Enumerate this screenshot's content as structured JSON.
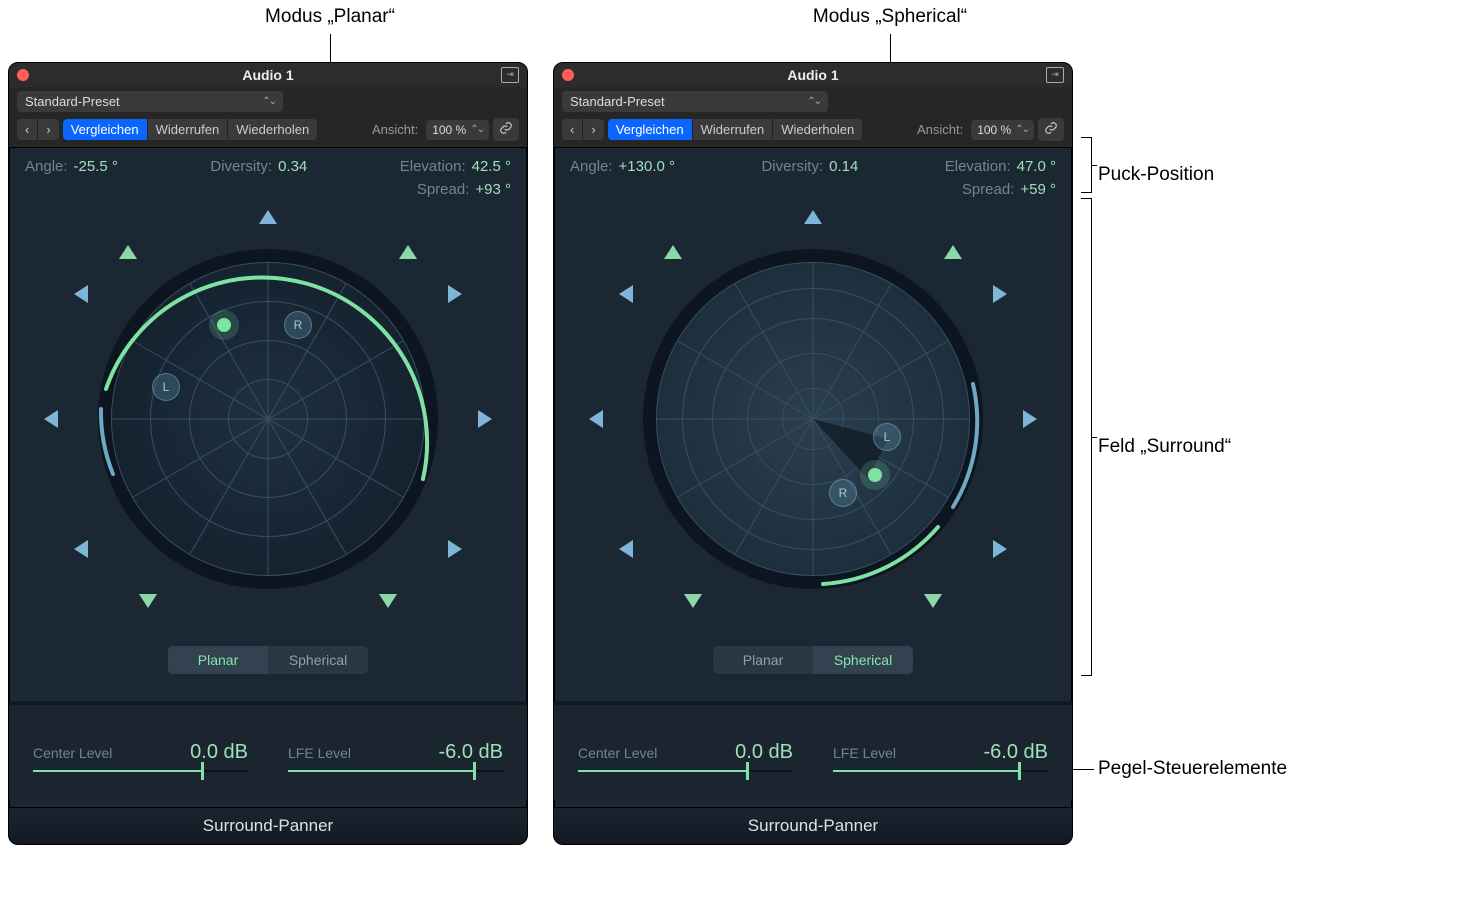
{
  "annotations": {
    "top_left": "Modus „Planar“",
    "top_right": "Modus „Spherical“",
    "right_1": "Puck-Position",
    "right_2": "Feld „Surround“",
    "right_3": "Pegel-Steuerelemente"
  },
  "shared": {
    "window_title": "Audio 1",
    "preset": "Standard-Preset",
    "nav_prev": "‹",
    "nav_next": "›",
    "btn_compare": "Vergleichen",
    "btn_undo": "Widerrufen",
    "btn_redo": "Wiederholen",
    "view_label": "Ansicht:",
    "zoom_value": "100 %",
    "link_glyph": "⧉",
    "labels": {
      "angle": "Angle:",
      "diversity": "Diversity:",
      "elevation": "Elevation:",
      "spread": "Spread:"
    },
    "mode_planar": "Planar",
    "mode_spherical": "Spherical",
    "center_level_label": "Center Level",
    "lfe_level_label": "LFE Level",
    "footer": "Surround-Panner"
  },
  "left": {
    "angle": "-25.5 °",
    "diversity": "0.34",
    "elevation": "42.5 °",
    "spread": "+93 °",
    "active_mode": "planar",
    "center_level": "0.0 dB",
    "center_fill_pct": 78,
    "lfe_level": "-6.0 dB",
    "lfe_fill_pct": 86
  },
  "right": {
    "angle": "+130.0 °",
    "diversity": "0.14",
    "elevation": "47.0 °",
    "spread": "+59 °",
    "active_mode": "spherical",
    "center_level": "0.0 dB",
    "center_fill_pct": 78,
    "lfe_level": "-6.0 dB",
    "lfe_fill_pct": 86
  },
  "markers": {
    "L": "L",
    "R": "R"
  },
  "colors": {
    "accent_green": "#7ee2a0",
    "accent_blue": "#7fb6d8",
    "label_dim": "#6f8690"
  }
}
